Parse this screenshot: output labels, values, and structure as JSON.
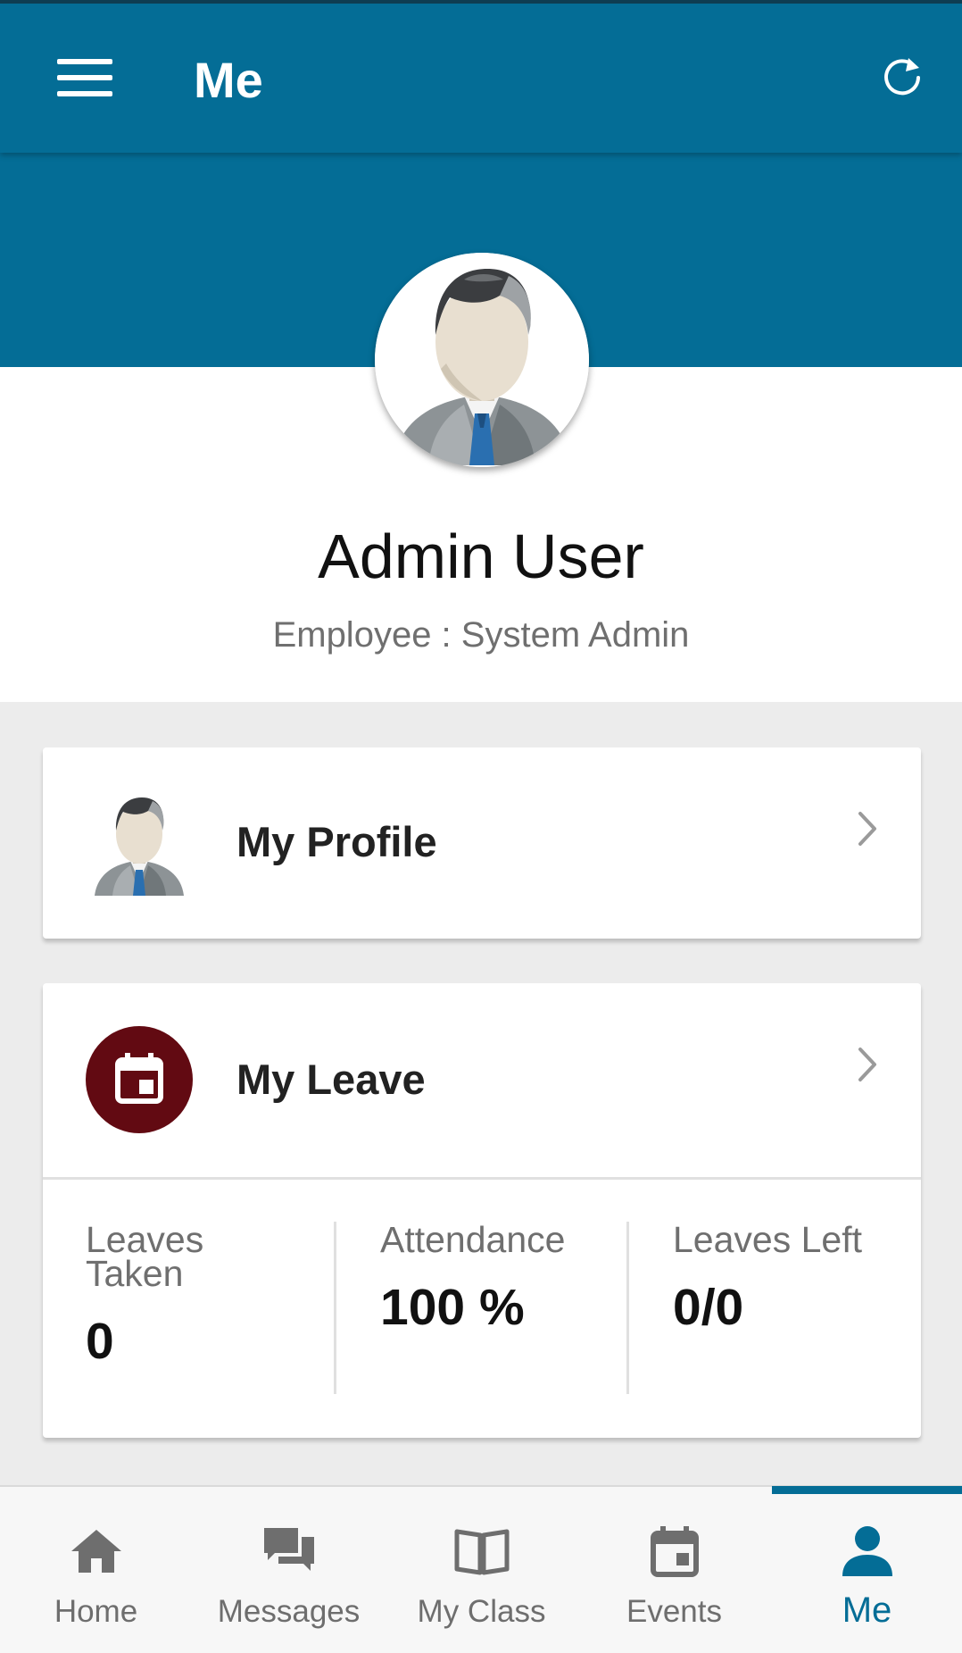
{
  "appbar": {
    "title": "Me",
    "menu_icon": "hamburger-menu-icon",
    "refresh_icon": "refresh-icon",
    "color": "#046d96"
  },
  "profile": {
    "name": "Admin User",
    "role": "Employee : System Admin",
    "avatar_icon": "businessman-avatar"
  },
  "cards": {
    "my_profile": {
      "label": "My Profile",
      "icon": "businessman-avatar"
    },
    "my_leave": {
      "label": "My Leave",
      "icon": "calendar-event-icon",
      "icon_bg": "#620a12",
      "stats": [
        {
          "label": "Leaves Taken",
          "value": "0"
        },
        {
          "label": "Attendance",
          "value": "100 %"
        },
        {
          "label": "Leaves Left",
          "value": "0/0"
        }
      ]
    }
  },
  "bottom_nav": {
    "items": [
      {
        "label": "Home",
        "icon": "home-icon"
      },
      {
        "label": "Messages",
        "icon": "chat-bubbles-icon"
      },
      {
        "label": "My Class",
        "icon": "open-book-icon"
      },
      {
        "label": "Events",
        "icon": "calendar-event-icon"
      },
      {
        "label": "Me",
        "icon": "person-icon"
      }
    ],
    "active": "Me",
    "active_color": "#046d96"
  }
}
